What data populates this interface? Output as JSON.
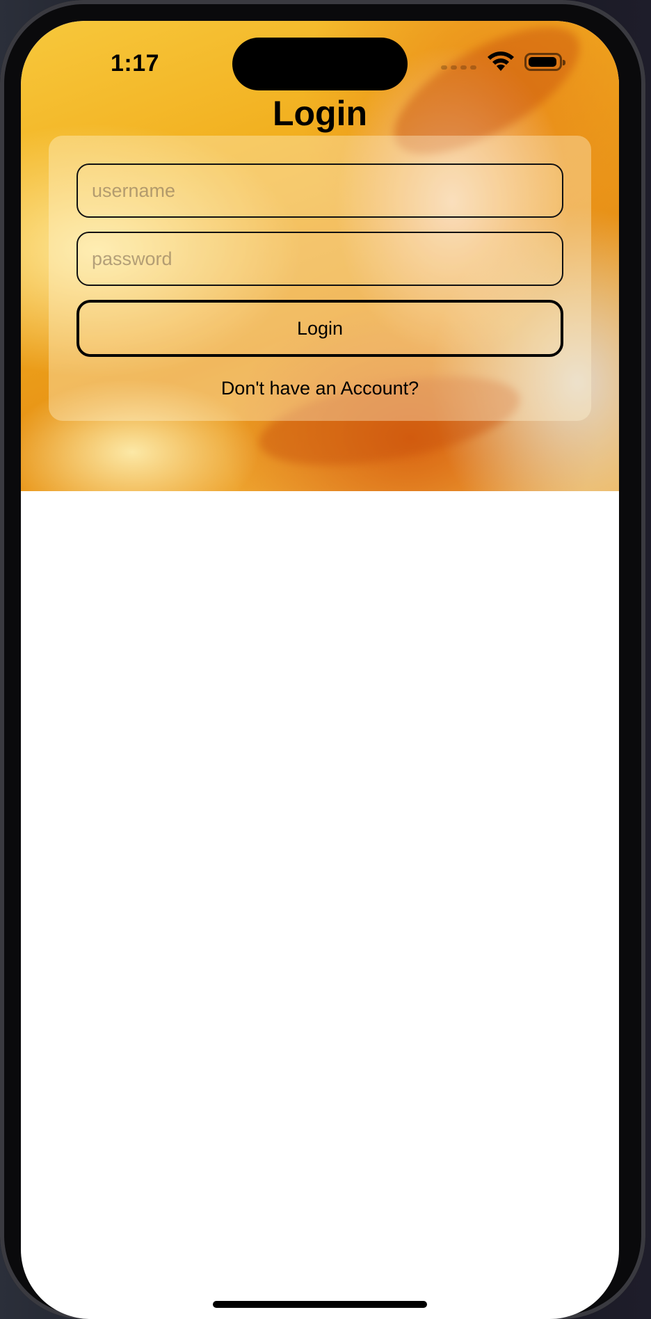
{
  "status_bar": {
    "time": "1:17",
    "icons": [
      "cellular-signal-icon",
      "wifi-icon",
      "battery-icon"
    ]
  },
  "login_screen": {
    "title": "Login",
    "username_placeholder": "username",
    "password_placeholder": "password",
    "username_value": "",
    "password_value": "",
    "login_button_label": "Login",
    "signup_link_label": "Don't have an Account?"
  },
  "colors": {
    "hero_gold": "#f2b020",
    "hero_orange": "#e89416",
    "card_tint": "#fff4d6",
    "text": "#000000"
  }
}
